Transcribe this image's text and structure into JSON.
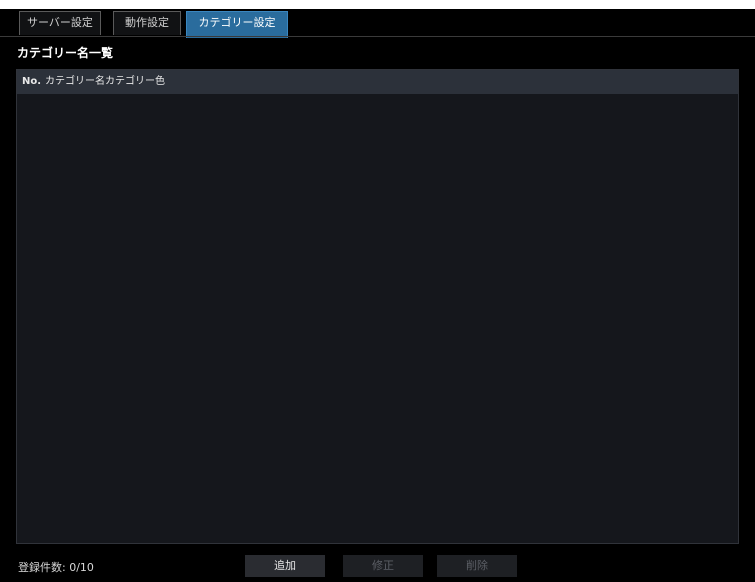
{
  "tabs": [
    {
      "label": "サーバー設定",
      "active": false
    },
    {
      "label": "動作設定",
      "active": false
    },
    {
      "label": "カテゴリー設定",
      "active": true
    }
  ],
  "section_title": "カテゴリー名一覧",
  "table": {
    "columns": [
      "No.",
      "カテゴリー名",
      "カテゴリー色"
    ],
    "rows": []
  },
  "footer": {
    "count_label": "登録件数: 0/10"
  },
  "buttons": {
    "add_label": "追加",
    "edit_label": "修正",
    "delete_label": "削除"
  },
  "colors": {
    "active_tab": "#2a6c9d",
    "table_bg": "#15171c",
    "header_bg": "#2c313a"
  }
}
